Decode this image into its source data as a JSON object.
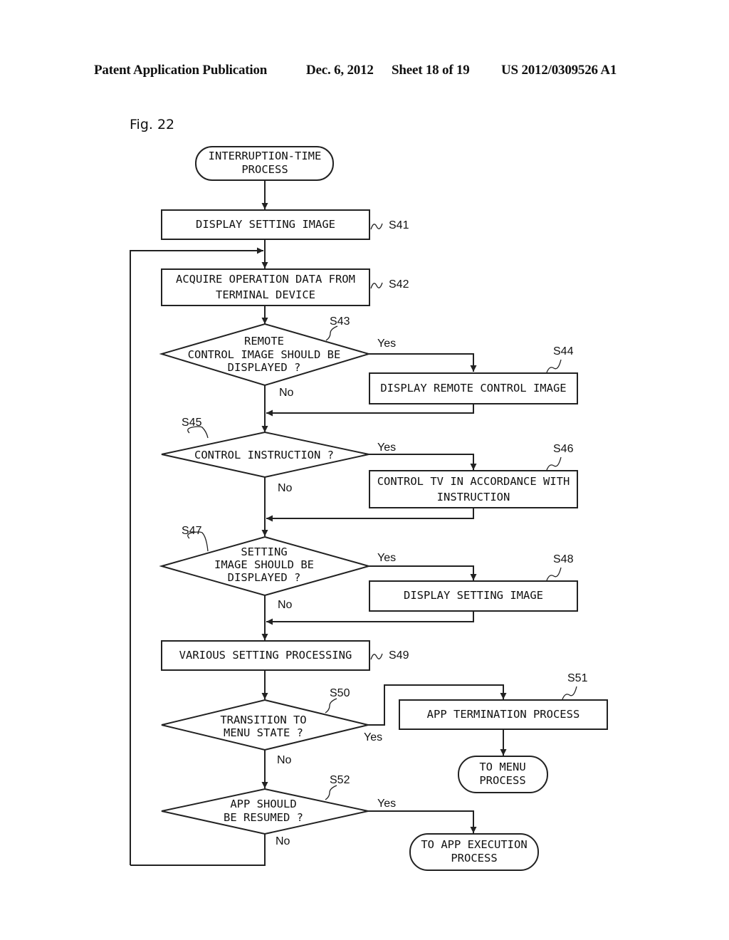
{
  "header": {
    "publication": "Patent Application Publication",
    "date": "Dec. 6, 2012",
    "sheet": "Sheet 18 of 19",
    "number": "US 2012/0309526 A1"
  },
  "figure_label": "Fig. 22",
  "nodes": {
    "start": {
      "type": "terminal",
      "lines": [
        "INTERRUPTION-TIME",
        "PROCESS"
      ]
    },
    "s41": {
      "type": "process",
      "step": "S41",
      "lines": [
        "DISPLAY SETTING IMAGE"
      ]
    },
    "s42": {
      "type": "process",
      "step": "S42",
      "lines": [
        "ACQUIRE OPERATION DATA FROM",
        "TERMINAL DEVICE"
      ]
    },
    "s43": {
      "type": "decision",
      "step": "S43",
      "lines": [
        "REMOTE",
        "CONTROL IMAGE SHOULD BE",
        "DISPLAYED ?"
      ]
    },
    "s44": {
      "type": "process",
      "step": "S44",
      "lines": [
        "DISPLAY REMOTE CONTROL IMAGE"
      ]
    },
    "s45": {
      "type": "decision",
      "step": "S45",
      "lines": [
        "CONTROL INSTRUCTION ?"
      ]
    },
    "s46": {
      "type": "process",
      "step": "S46",
      "lines": [
        "CONTROL TV IN ACCORDANCE WITH",
        "INSTRUCTION"
      ]
    },
    "s47": {
      "type": "decision",
      "step": "S47",
      "lines": [
        "SETTING",
        "IMAGE SHOULD BE",
        "DISPLAYED ?"
      ]
    },
    "s48": {
      "type": "process",
      "step": "S48",
      "lines": [
        "DISPLAY SETTING IMAGE"
      ]
    },
    "s49": {
      "type": "process",
      "step": "S49",
      "lines": [
        "VARIOUS SETTING PROCESSING"
      ]
    },
    "s50": {
      "type": "decision",
      "step": "S50",
      "lines": [
        "TRANSITION TO",
        "MENU STATE ?"
      ]
    },
    "s51": {
      "type": "process",
      "step": "S51",
      "lines": [
        "APP TERMINATION PROCESS"
      ]
    },
    "menu": {
      "type": "terminal",
      "lines": [
        "TO MENU",
        "PROCESS"
      ]
    },
    "s52": {
      "type": "decision",
      "step": "S52",
      "lines": [
        "APP SHOULD",
        "BE RESUMED ?"
      ]
    },
    "exec": {
      "type": "terminal",
      "lines": [
        "TO APP EXECUTION",
        "PROCESS"
      ]
    }
  },
  "edge_labels": {
    "yes": "Yes",
    "no": "No"
  },
  "edges": [
    {
      "from": "start",
      "to": "s41"
    },
    {
      "from": "s41",
      "to": "s42"
    },
    {
      "from": "s42",
      "to": "s43"
    },
    {
      "from": "s43",
      "to": "s44",
      "label": "Yes"
    },
    {
      "from": "s43",
      "to": "s45",
      "label": "No"
    },
    {
      "from": "s44",
      "to": "s45"
    },
    {
      "from": "s45",
      "to": "s46",
      "label": "Yes"
    },
    {
      "from": "s45",
      "to": "s47",
      "label": "No"
    },
    {
      "from": "s46",
      "to": "s47"
    },
    {
      "from": "s47",
      "to": "s48",
      "label": "Yes"
    },
    {
      "from": "s47",
      "to": "s49",
      "label": "No"
    },
    {
      "from": "s48",
      "to": "s49"
    },
    {
      "from": "s49",
      "to": "s50"
    },
    {
      "from": "s50",
      "to": "s51",
      "label": "Yes"
    },
    {
      "from": "s50",
      "to": "s52",
      "label": "No"
    },
    {
      "from": "s51",
      "to": "menu"
    },
    {
      "from": "s52",
      "to": "exec",
      "label": "Yes"
    },
    {
      "from": "s52",
      "to": "s42",
      "label": "No"
    }
  ]
}
